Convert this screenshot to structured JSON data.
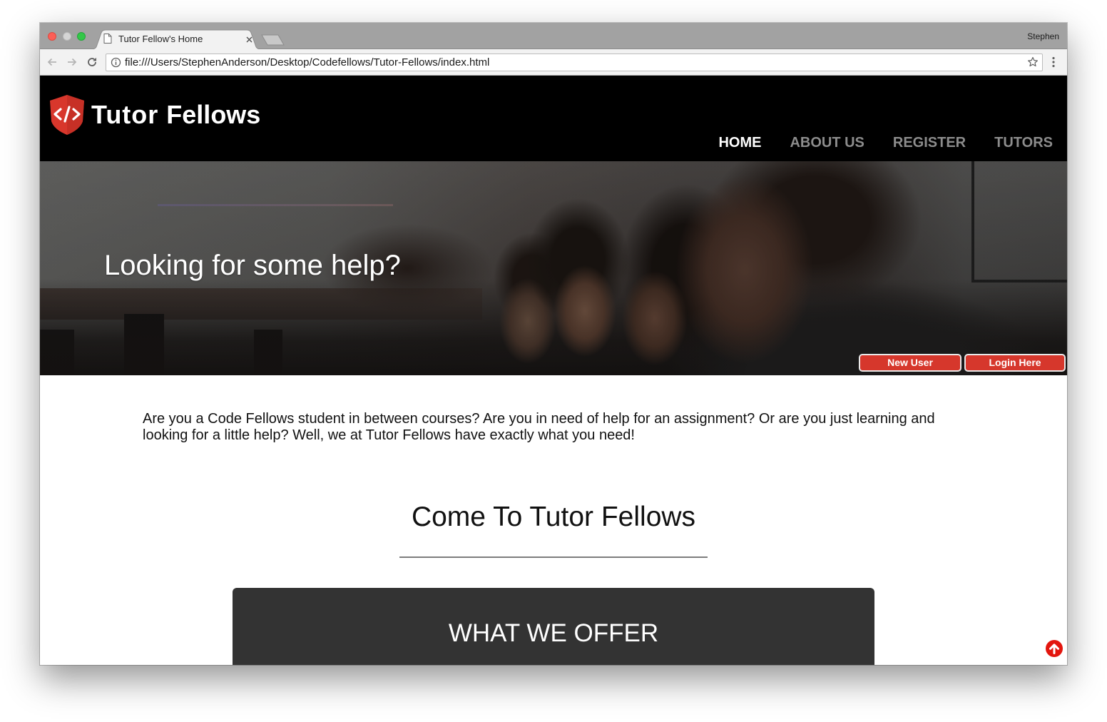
{
  "browser": {
    "tab": {
      "title": "Tutor Fellow's Home",
      "icon": "page-icon",
      "close_icon": "close-icon"
    },
    "profile": {
      "name": "Stephen"
    },
    "toolbar": {
      "back_icon": "back-arrow-icon",
      "forward_icon": "forward-arrow-icon",
      "reload_icon": "reload-icon",
      "site_info_icon": "info-icon",
      "bookmark_icon": "star-icon",
      "menu_icon": "more-vertical-icon"
    },
    "address_bar": {
      "url": "file:///Users/StephenAnderson/Desktop/Codefellows/Tutor-Fellows/index.html"
    }
  },
  "site": {
    "logo": {
      "mark": "</>",
      "name_part1": "Tutor",
      "name_part2": "Fellows"
    },
    "nav": [
      {
        "label": "HOME",
        "active": true
      },
      {
        "label": "ABOUT US",
        "active": false
      },
      {
        "label": "REGISTER",
        "active": false
      },
      {
        "label": "TUTORS",
        "active": false
      }
    ],
    "hero": {
      "heading": "Looking for some help?",
      "new_user_button": "New User",
      "login_button": "Login Here"
    },
    "intro_text": "Are you a Code Fellows student in between courses? Are you in need of help for an assignment? Or are you just learning and looking for a little help? Well, we at Tutor Fellows have exactly what you need!",
    "section_heading": "Come To Tutor Fellows",
    "offer": {
      "heading": "WHAT WE OFFER"
    },
    "back_to_top_icon": "arrow-up-circle-icon"
  },
  "colors": {
    "titlebar": "#a2a2a2",
    "toolbar": "#f2f2f2",
    "header_bg": "#000000",
    "nav_active": "#ffffff",
    "nav_inactive": "#8c8c8c",
    "accent_red": "#d6372c",
    "offer_panel": "#333333",
    "body_text": "#111111"
  }
}
